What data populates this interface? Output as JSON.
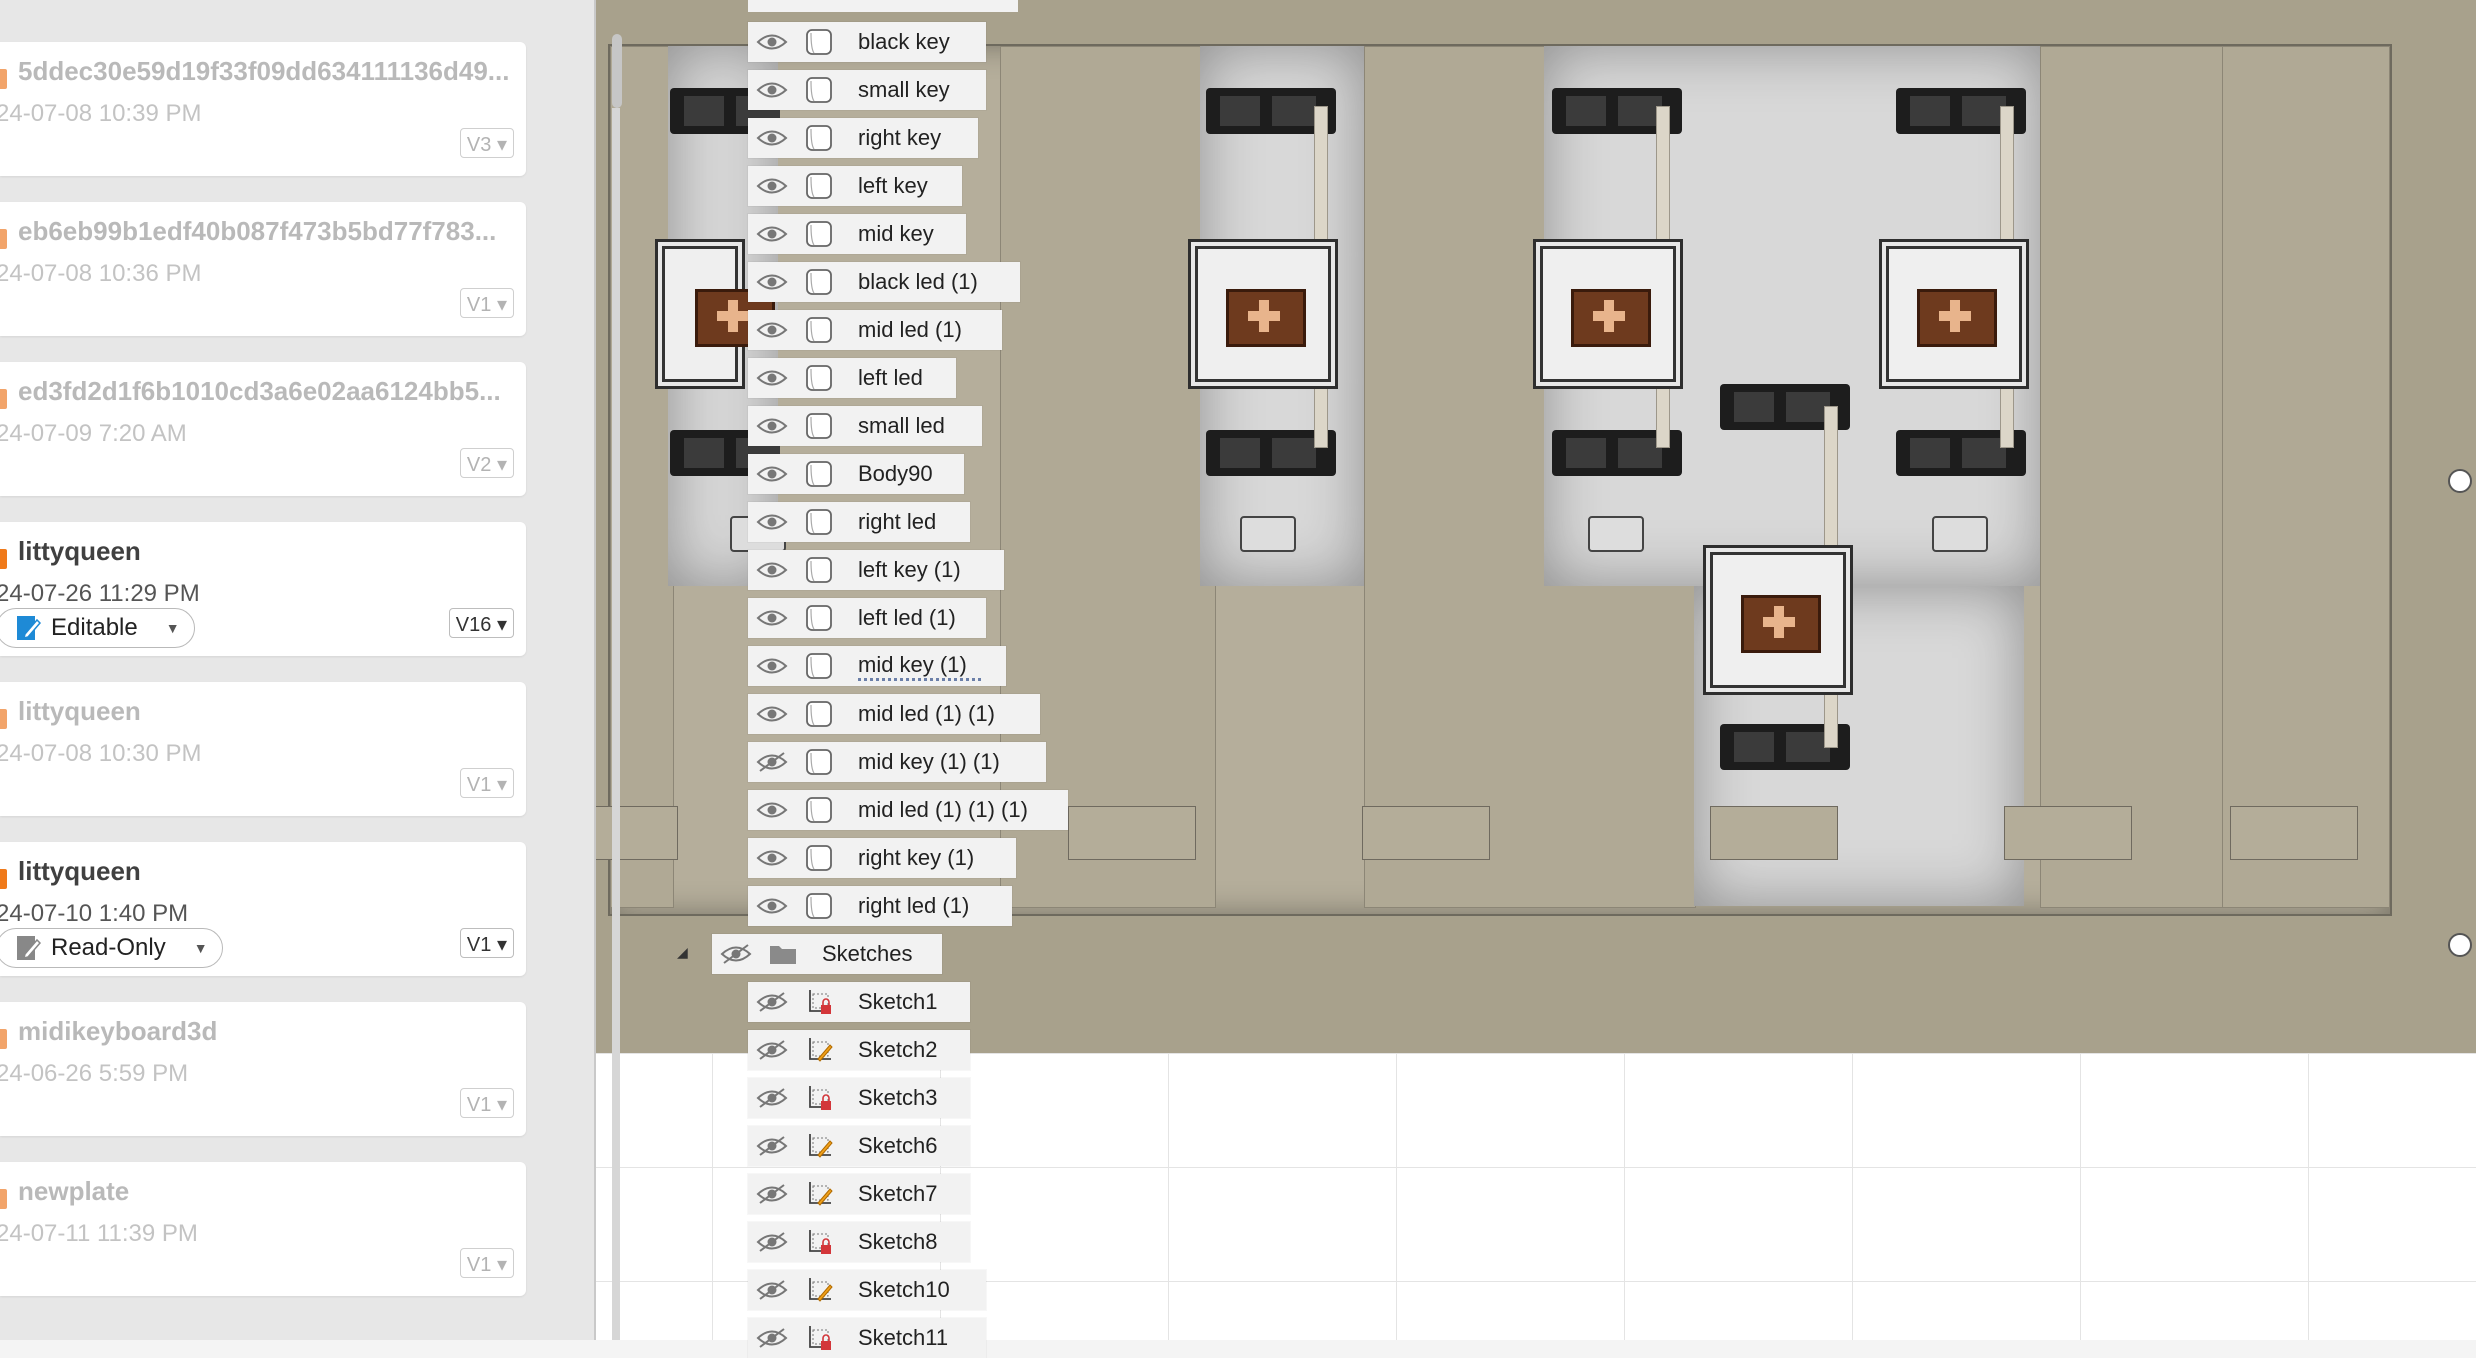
{
  "data_panel": {
    "cards": [
      {
        "title": "5ddec30e59d19f33f09dd634111136d49...",
        "date": "24-07-08 10:39 PM",
        "version": "V3",
        "active": false
      },
      {
        "title": "eb6eb99b1edf40b087f473b5bd77f783...",
        "date": "24-07-08 10:36 PM",
        "version": "V1",
        "active": false
      },
      {
        "title": "ed3fd2d1f6b1010cd3a6e02aa6124bb5...",
        "date": "24-07-09 7:20 AM",
        "version": "V2",
        "active": false
      },
      {
        "title": "littyqueen",
        "date": "24-07-26 11:29 PM",
        "version": "V16",
        "active": true,
        "permission": "Editable"
      },
      {
        "title": "littyqueen",
        "date": "24-07-08 10:30 PM",
        "version": "V1",
        "active": false
      },
      {
        "title": "littyqueen",
        "date": "24-07-10 1:40 PM",
        "version": "V1",
        "active": true,
        "permission": "Read-Only"
      },
      {
        "title": "midikeyboard3d",
        "date": "24-06-26 5:59 PM",
        "version": "V1",
        "active": false
      },
      {
        "title": "newplate",
        "date": "24-07-11 11:39 PM",
        "version": "V1",
        "active": false
      }
    ]
  },
  "browser": {
    "bodies": [
      "black key",
      "small key",
      "right key",
      "left key",
      "mid key",
      "black led (1)",
      "mid led (1)",
      "left led",
      "small led",
      "Body90",
      "right led",
      "left key (1)",
      "left led (1)",
      "mid key (1)",
      "mid led (1) (1)",
      "mid key (1) (1)",
      "mid led (1) (1) (1)",
      "right key (1)",
      "right led (1)"
    ],
    "sketches_folder": "Sketches",
    "sketches": [
      "Sketch1",
      "Sketch2",
      "Sketch3",
      "Sketch6",
      "Sketch7",
      "Sketch8",
      "Sketch10",
      "Sketch11"
    ]
  },
  "colors": {
    "accent_orange": "#f07a1a",
    "plate": "#b5ae9b",
    "editable_blue": "#1e8ad6"
  }
}
